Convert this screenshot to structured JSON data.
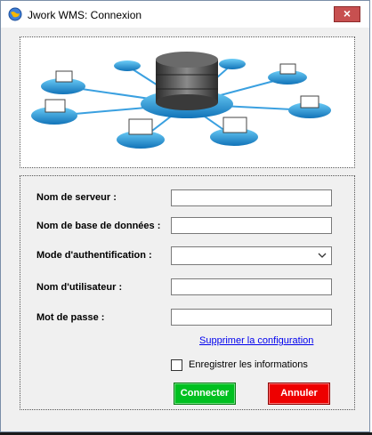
{
  "window": {
    "title": "Jwork WMS: Connexion",
    "close_label": "×"
  },
  "form": {
    "server_label": "Nom de serveur :",
    "server_value": "",
    "database_label": "Nom de base de données :",
    "database_value": "",
    "auth_label": "Mode d'authentification :",
    "auth_value": "",
    "user_label": "Nom d'utilisateur :",
    "user_value": "",
    "password_label": "Mot de passe :",
    "password_value": "",
    "delete_config_link": "Supprimer la configuration",
    "save_info_label": "Enregistrer les informations",
    "save_info_checked": false
  },
  "buttons": {
    "connect_label": "Connecter",
    "cancel_label": "Annuler"
  },
  "colors": {
    "connect": "#00c020",
    "cancel": "#ee0000",
    "network_disk": "#2a9fe0",
    "server": "#4a4a4a"
  },
  "icons": {
    "app": "globe-app-icon",
    "network": "database-network-illustration"
  }
}
